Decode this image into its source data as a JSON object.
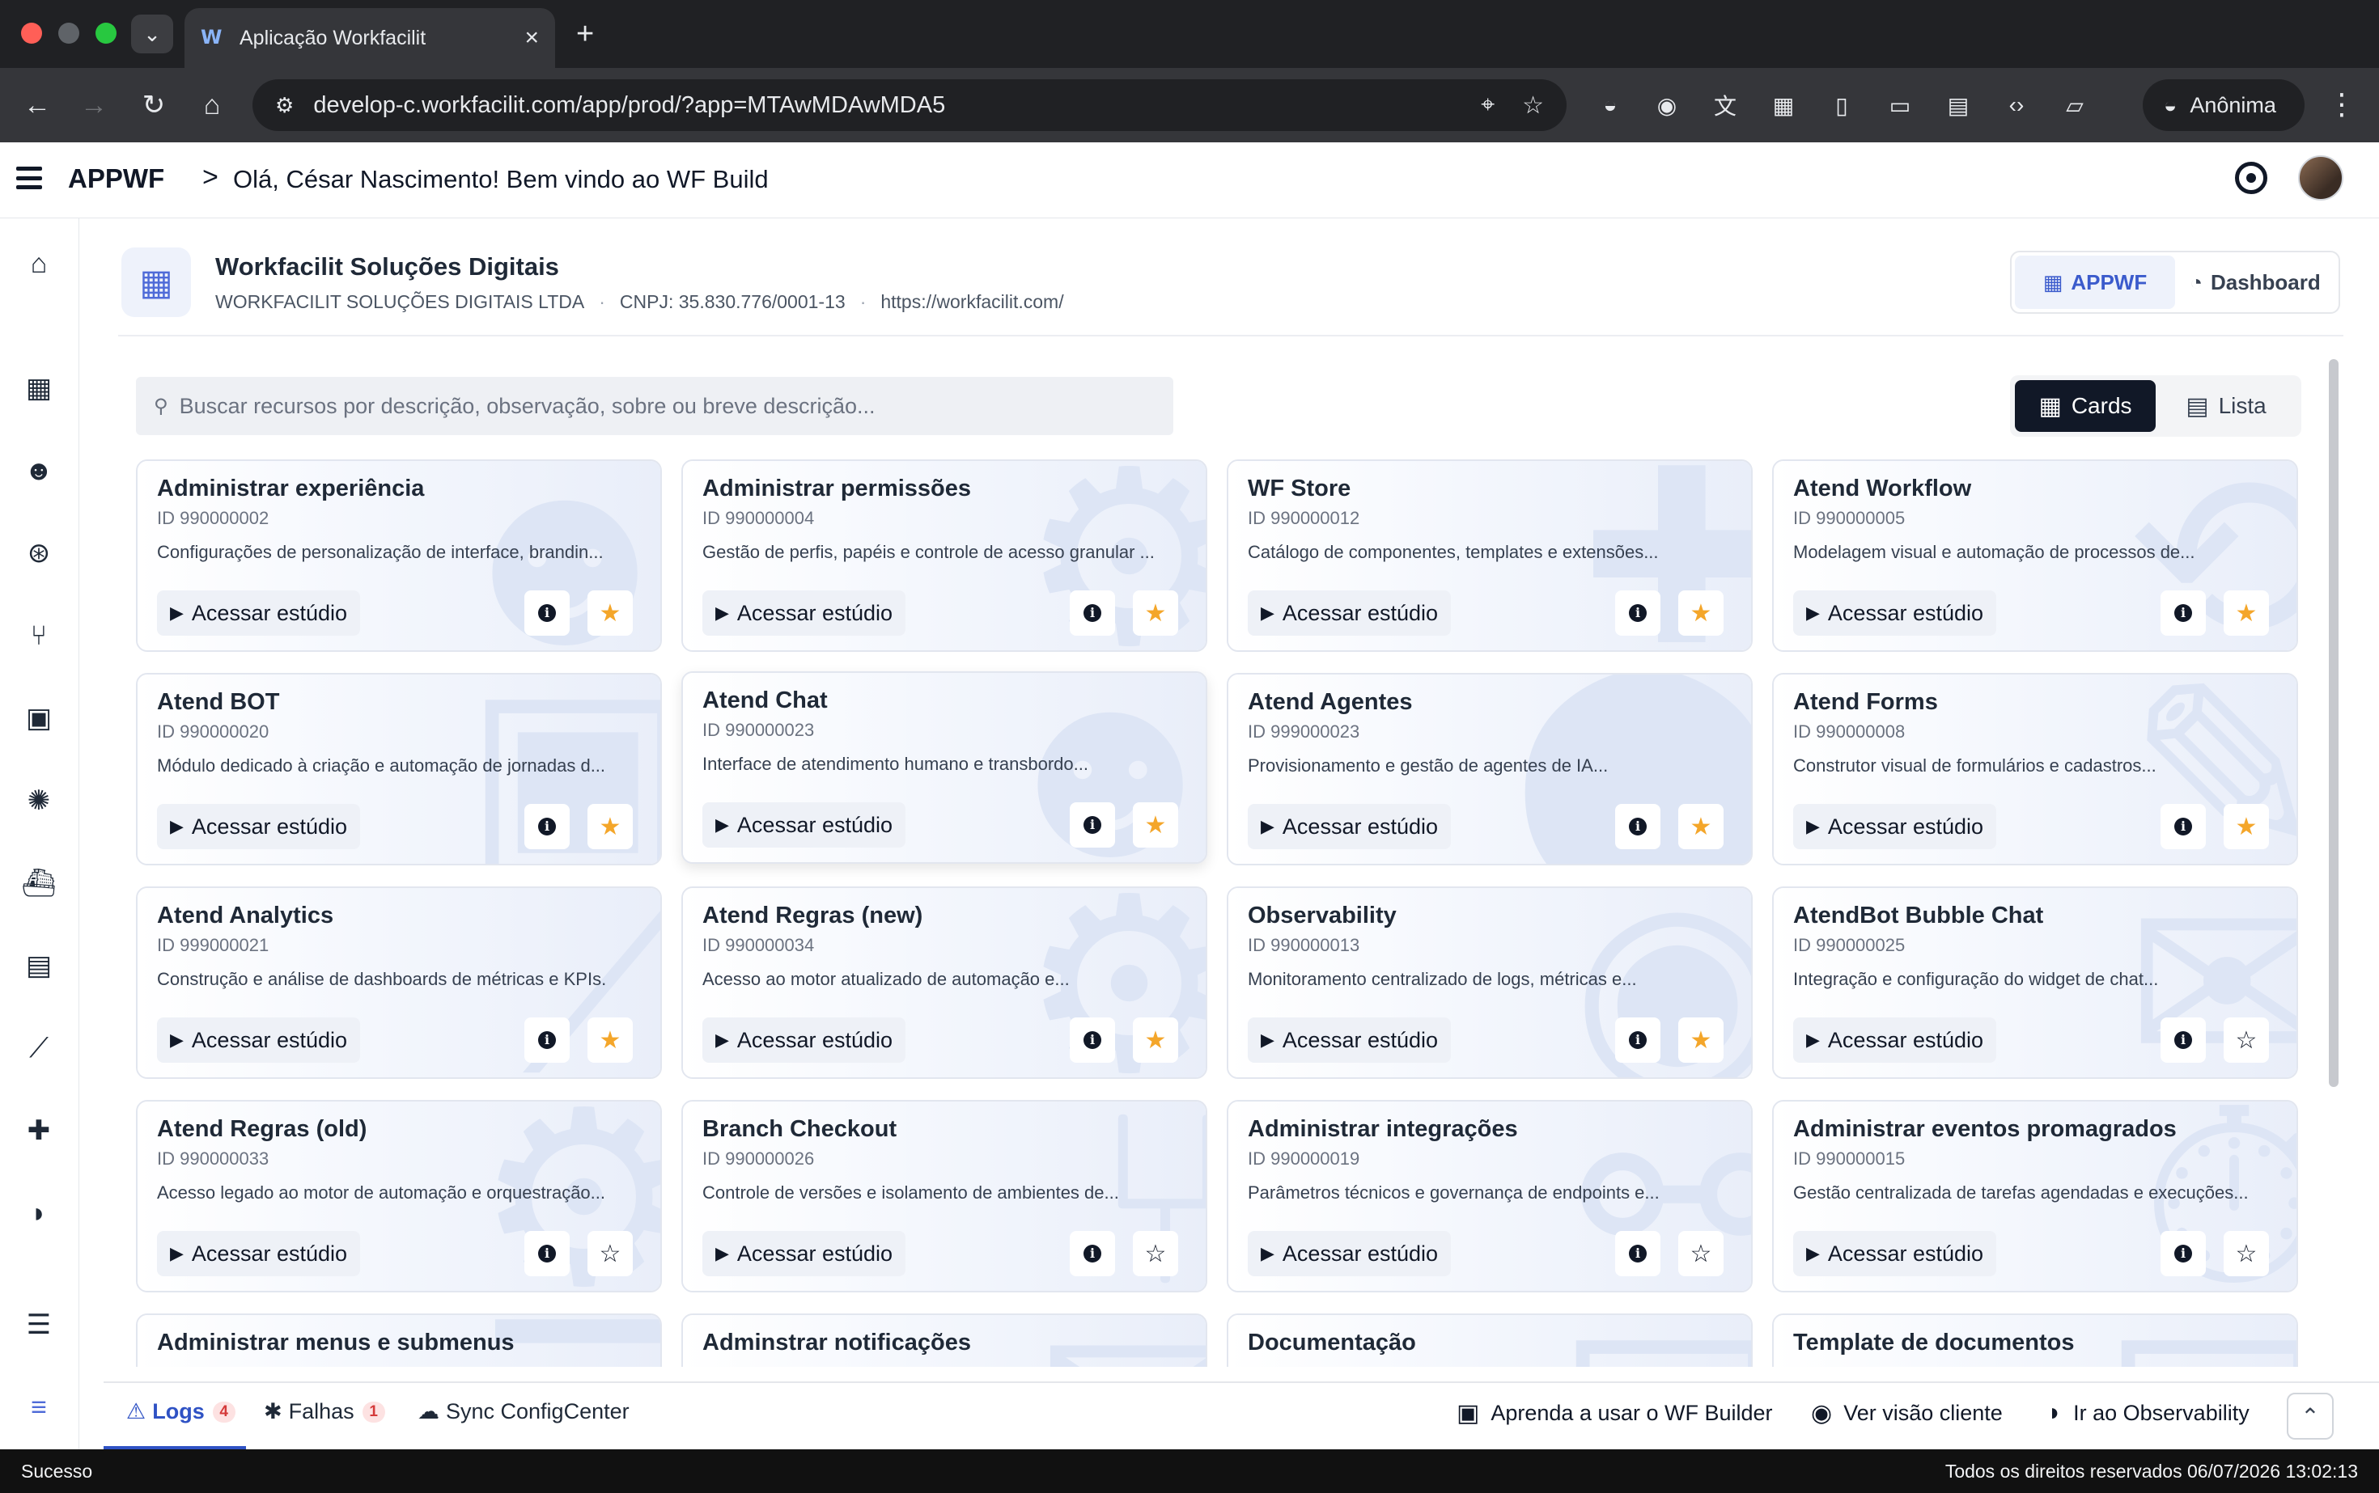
{
  "browser": {
    "tab_title": "Aplicação Workfacilit",
    "url": "develop-c.workfacilit.com/app/prod/?app=MTAwMDAwMDA5",
    "profile_label": "Anônima"
  },
  "header": {
    "brand": "APPWF",
    "separator": ">",
    "greeting": "Olá, César Nascimento! Bem vindo ao WF Build"
  },
  "org": {
    "name": "Workfacilit Soluções Digitais",
    "legal_name": "WORKFACILIT SOLUÇÕES DIGITAIS LTDA",
    "cnpj": "CNPJ: 35.830.776/0001-13",
    "website": "https://workfacilit.com/",
    "separator": "·",
    "views": [
      {
        "label": "APPWF",
        "icon": "grid-icon",
        "active": true
      },
      {
        "label": "Dashboard",
        "icon": "gauge-icon",
        "active": false
      }
    ]
  },
  "search": {
    "placeholder": "Buscar recursos por descrição, observação, sobre ou breve descrição..."
  },
  "layout_toggle": {
    "cards_label": "Cards",
    "list_label": "Lista",
    "active": "cards"
  },
  "colors": {
    "accent": "#2f52c4",
    "star_active": "#f4a62a",
    "card_watermark": "#dde5f5"
  },
  "card_action_label": "Acessar estúdio",
  "cards": [
    {
      "title": "Administrar experiência",
      "id": "ID 990000002",
      "desc": "Configurações de personalização de interface, brandin...",
      "favorite": true
    },
    {
      "title": "Administrar permissões",
      "id": "ID 990000004",
      "desc": "Gestão de perfis, papéis e controle de acesso granular ...",
      "favorite": true
    },
    {
      "title": "WF Store",
      "id": "ID 990000012",
      "desc": "Catálogo de componentes, templates e extensões...",
      "favorite": true
    },
    {
      "title": "Atend Workflow",
      "id": "ID 990000005",
      "desc": "Modelagem visual e automação de processos de...",
      "favorite": true
    },
    {
      "title": "Atend BOT",
      "id": "ID 990000020",
      "desc": "Módulo dedicado à criação e automação de jornadas d...",
      "favorite": true
    },
    {
      "title": "Atend Chat",
      "id": "ID 990000023",
      "desc": "Interface de atendimento humano e transbordo...",
      "favorite": true
    },
    {
      "title": "Atend Agentes",
      "id": "ID 999000023",
      "desc": "Provisionamento e gestão de agentes de IA...",
      "favorite": true
    },
    {
      "title": "Atend Forms",
      "id": "ID 990000008",
      "desc": "Construtor visual de formulários e cadastros...",
      "favorite": true
    },
    {
      "title": "Atend Analytics",
      "id": "ID 999000021",
      "desc": "Construção e análise de dashboards de métricas e KPIs.",
      "favorite": true
    },
    {
      "title": "Atend Regras (new)",
      "id": "ID 990000034",
      "desc": "Acesso ao motor atualizado de automação e...",
      "favorite": true
    },
    {
      "title": "Observability",
      "id": "ID 990000013",
      "desc": "Monitoramento centralizado de logs, métricas e...",
      "favorite": true
    },
    {
      "title": "AtendBot Bubble Chat",
      "id": "ID 990000025",
      "desc": "Integração e configuração do widget de chat...",
      "favorite": false
    },
    {
      "title": "Atend Regras (old)",
      "id": "ID 990000033",
      "desc": "Acesso legado ao motor de automação e orquestração...",
      "favorite": false
    },
    {
      "title": "Branch Checkout",
      "id": "ID 990000026",
      "desc": "Controle de versões e isolamento de ambientes de...",
      "favorite": false
    },
    {
      "title": "Administrar integrações",
      "id": "ID 990000019",
      "desc": "Parâmetros técnicos e governança de endpoints e...",
      "favorite": false
    },
    {
      "title": "Administrar eventos promagrados",
      "id": "ID 990000015",
      "desc": "Gestão centralizada de tarefas agendadas e execuções...",
      "favorite": false
    },
    {
      "title": "Administrar menus e submenus",
      "id": "",
      "desc": "",
      "favorite": false
    },
    {
      "title": "Adminstrar notificações",
      "id": "",
      "desc": "",
      "favorite": false
    },
    {
      "title": "Documentação",
      "id": "",
      "desc": "",
      "favorite": false
    },
    {
      "title": "Template de documentos",
      "id": "",
      "desc": "",
      "favorite": false
    }
  ],
  "bottom_bar": {
    "logs_label": "Logs",
    "logs_count": "4",
    "failures_label": "Falhas",
    "failures_count": "1",
    "sync_label": "Sync ConfigCenter",
    "learn_label": "Aprenda a usar o WF Builder",
    "client_view_label": "Ver visão cliente",
    "observability_label": "Ir ao Observability"
  },
  "status_bar": {
    "status": "Sucesso",
    "copyright": "Todos os direitos reservados 06/07/2026 13:02:13"
  }
}
